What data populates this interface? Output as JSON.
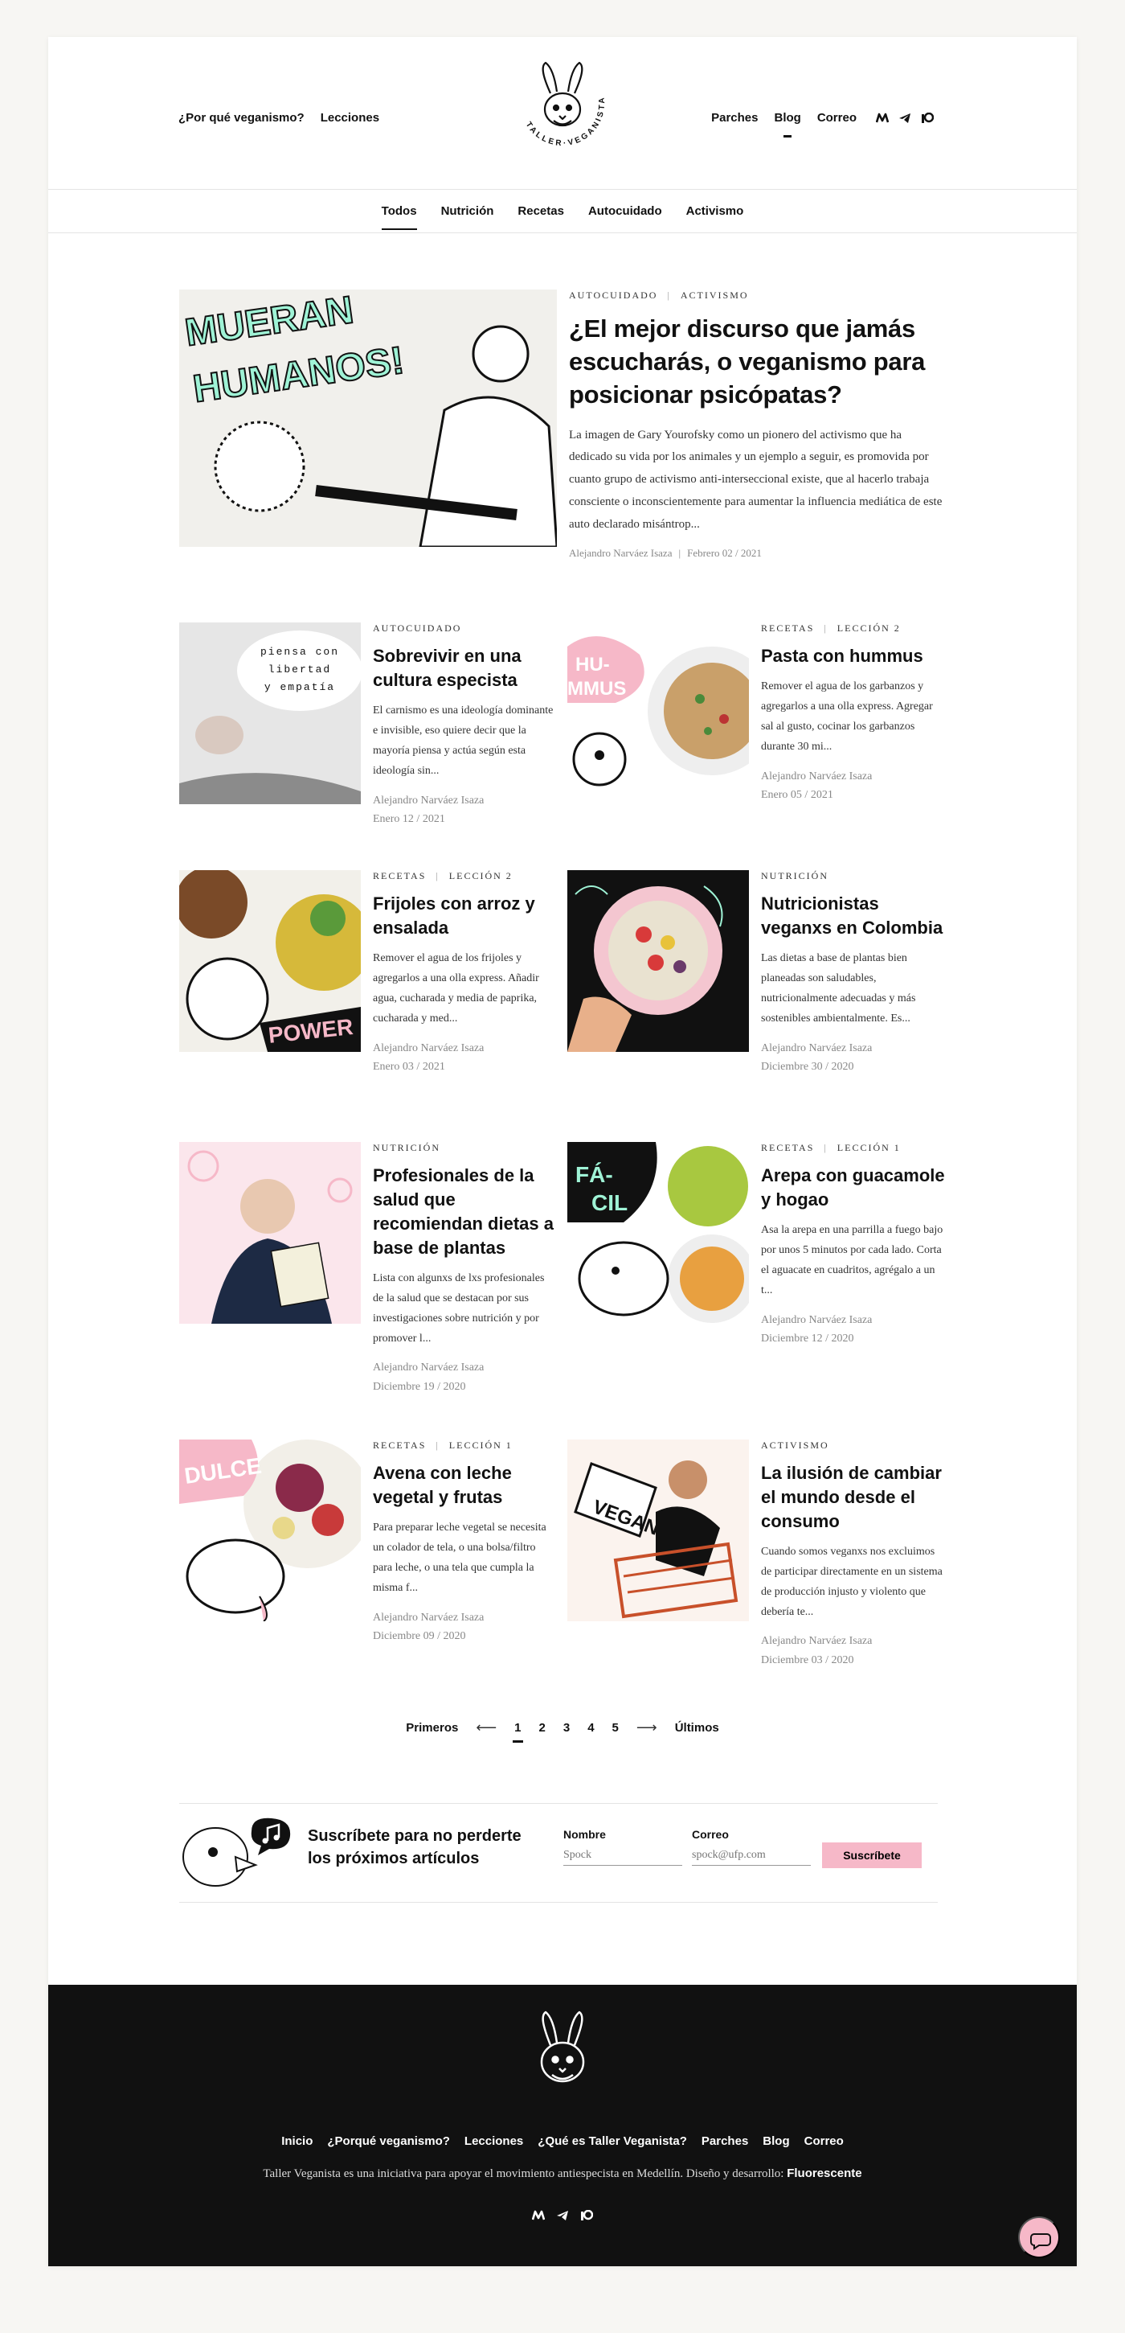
{
  "header": {
    "nav_left": [
      "¿Por qué veganismo?",
      "Lecciones"
    ],
    "nav_right": [
      "Parches",
      "Blog",
      "Correo"
    ],
    "active_nav": "Blog",
    "logo_text": "TALLER·VEGANISTA",
    "social_icons": [
      "medium-icon",
      "telegram-icon",
      "patreon-icon"
    ]
  },
  "categories": {
    "items": [
      "Todos",
      "Nutrición",
      "Recetas",
      "Autocuidado",
      "Activismo"
    ],
    "active": "Todos"
  },
  "featured": {
    "tags": [
      "Autocuidado",
      "Activismo"
    ],
    "title": "¿El mejor discurso que jamás escucharás, o veganismo para posicionar psicópatas?",
    "excerpt": "La imagen de Gary Yourofsky como un pionero del activismo que ha dedicado su vida por los animales y un ejemplo a seguir, es promovida por cuanto grupo de activismo anti-interseccional existe, que al hacerlo trabaja consciente o inconscientemente para aumentar la influencia mediática de este auto declarado misántrop...",
    "author": "Alejandro Narváez Isaza",
    "date": "Febrero 02 / 2021",
    "image_text": "MUERAN HUMANOS!"
  },
  "posts": [
    {
      "tags": [
        "Autocuidado"
      ],
      "title": "Sobrevivir en una cultura especista",
      "excerpt": "El carnismo es una ideología dominante e invisible, eso quiere decir que la mayoría piensa y actúa según esta ideología sin...",
      "author": "Alejandro Narváez Isaza",
      "date": "Enero 12 / 2021",
      "image_text": "piensa con libertad y empatía"
    },
    {
      "tags": [
        "Recetas",
        "Lección 2"
      ],
      "title": "Pasta con hummus",
      "excerpt": "Remover el agua de los garbanzos y agregarlos a una olla express. Agregar sal al gusto, cocinar los garbanzos durante 30 mi...",
      "author": "Alejandro Narváez Isaza",
      "date": "Enero 05 / 2021",
      "image_text": "HU-MMUS"
    },
    {
      "tags": [
        "Recetas",
        "Lección 2"
      ],
      "title": "Frijoles con arroz y ensalada",
      "excerpt": "Remover el agua de los frijoles y agregarlos a una olla express. Añadir agua, cucharada y media de paprika, cucharada y med...",
      "author": "Alejandro Narváez Isaza",
      "date": "Enero 03 / 2021",
      "image_text": "POWER"
    },
    {
      "tags": [
        "Nutrición"
      ],
      "title": "Nutricionistas veganxs en Colombia",
      "excerpt": "Las dietas a base de plantas bien planeadas son saludables, nutricionalmente adecuadas y más sostenibles ambientalmente. Es...",
      "author": "Alejandro Narváez Isaza",
      "date": "Diciembre 30 / 2020",
      "image_text": ""
    },
    {
      "tags": [
        "Nutrición"
      ],
      "title": "Profesionales de la salud que recomiendan dietas a base de plantas",
      "excerpt": "Lista con algunxs de lxs profesionales de la salud que se destacan por sus investigaciones sobre nutrición y por promover l...",
      "author": "Alejandro Narváez Isaza",
      "date": "Diciembre 19 / 2020",
      "image_text": ""
    },
    {
      "tags": [
        "Recetas",
        "Lección 1"
      ],
      "title": "Arepa con guacamole y hogao",
      "excerpt": "Asa la arepa en una parrilla a fuego bajo por unos 5 minutos por cada lado. Corta el aguacate en cuadritos, agrégalo a un t...",
      "author": "Alejandro Narváez Isaza",
      "date": "Diciembre 12 / 2020",
      "image_text": "FÁ-CIL"
    },
    {
      "tags": [
        "Recetas",
        "Lección 1"
      ],
      "title": "Avena con leche vegetal y frutas",
      "excerpt": "Para preparar leche vegetal se necesita un colador de tela, o una bolsa/filtro para leche, o una tela que cumpla la misma f...",
      "author": "Alejandro Narváez Isaza",
      "date": "Diciembre 09 / 2020",
      "image_text": "DULCE"
    },
    {
      "tags": [
        "Activismo"
      ],
      "title": "La ilusión de cambiar el mundo desde el consumo",
      "excerpt": "Cuando somos veganxs nos excluimos de participar directamente en un sistema de producción injusto y violento que debería te...",
      "author": "Alejandro Narváez Isaza",
      "date": "Diciembre 03 / 2020",
      "image_text": "VEGAN"
    }
  ],
  "pagination": {
    "first": "Primeros",
    "last": "Últimos",
    "pages": [
      "1",
      "2",
      "3",
      "4",
      "5"
    ],
    "current": "1"
  },
  "subscribe": {
    "title": "Suscríbete para no perderte los próximos artículos",
    "name_label": "Nombre",
    "name_placeholder": "Spock",
    "email_label": "Correo",
    "email_placeholder": "spock@ufp.com",
    "button": "Suscríbete"
  },
  "footer": {
    "nav": [
      "Inicio",
      "¿Porqué veganismo?",
      "Lecciones",
      "¿Qué es Taller Veganista?",
      "Parches",
      "Blog",
      "Correo"
    ],
    "credit": "Taller Veganista es una iniciativa para apoyar el movimiento antiespecista en Medellín. Diseño y desarrollo:",
    "credit_link": "Fluorescente"
  },
  "colors": {
    "accent_pink": "#f6b8c8",
    "mint": "#9ff3d6",
    "footer_bg": "#111111",
    "page_bg": "#f7f6f3"
  }
}
